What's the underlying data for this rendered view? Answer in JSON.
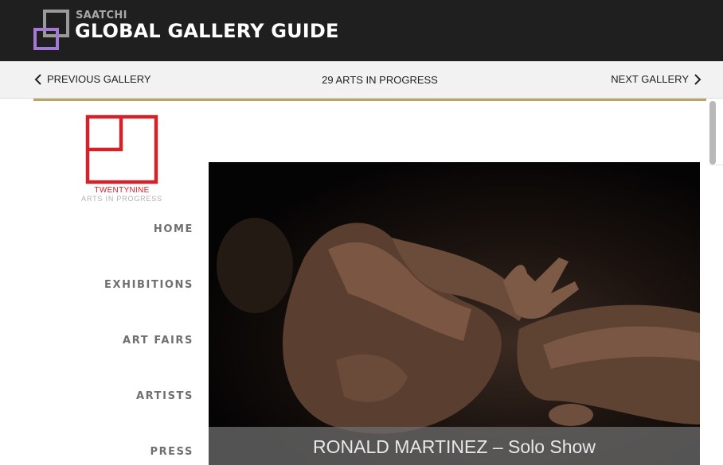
{
  "header": {
    "brand_top": "SAATCHI",
    "brand_title": "GLOBAL GALLERY GUIDE",
    "colors": {
      "background": "#1f1f1f",
      "accent_purple": "#a479d6",
      "logo_grey": "#9a9a9a"
    }
  },
  "navbar": {
    "prev_label": "PREVIOUS GALLERY",
    "gallery_name": "29 ARTS IN PROGRESS",
    "next_label": "NEXT GALLERY",
    "prev_icon": "chevron-left-icon",
    "next_icon": "chevron-right-icon"
  },
  "gallery_site": {
    "logo_name": "TWENTYNINE",
    "logo_tagline": "ARTS IN PROGRESS",
    "logo_color": "#d2232a",
    "menu": [
      {
        "label": "HOME"
      },
      {
        "label": "EXHIBITIONS"
      },
      {
        "label": "ART FAIRS"
      },
      {
        "label": "ARTISTS"
      },
      {
        "label": "PRESS"
      }
    ],
    "hero": {
      "caption": "RONALD MARTINEZ – Solo Show"
    }
  },
  "accent_rule_color": "#b9a460"
}
